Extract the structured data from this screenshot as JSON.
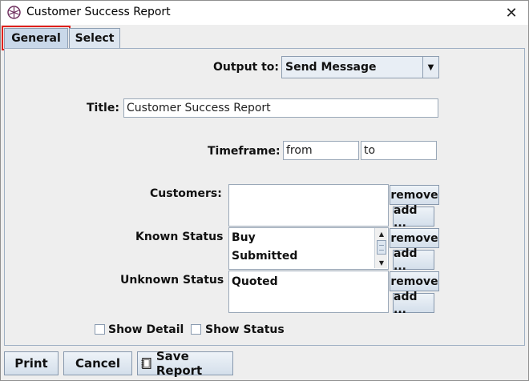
{
  "window": {
    "title": "Customer Success Report"
  },
  "tabs": [
    {
      "label": "General",
      "selected": true
    },
    {
      "label": "Select",
      "selected": false
    }
  ],
  "form": {
    "output_to": {
      "label": "Output to:",
      "value": "Send Message"
    },
    "title": {
      "label": "Title:",
      "value": "Customer Success Report"
    },
    "timeframe": {
      "label": "Timeframe:",
      "from_placeholder": "from",
      "to_placeholder": "to"
    },
    "customers": {
      "label": "Customers:",
      "items": []
    },
    "known_status": {
      "label": "Known Status",
      "items": [
        "Buy",
        "Submitted"
      ]
    },
    "unknown_status": {
      "label": "Unknown Status",
      "items": [
        "Quoted"
      ]
    },
    "remove_label": "remove",
    "add_label": "add ...",
    "show_detail": {
      "label": "Show Detail",
      "checked": false
    },
    "show_status": {
      "label": "Show Status",
      "checked": false
    }
  },
  "footer": {
    "print_label": "Print",
    "cancel_label": "Cancel",
    "save_label": "Save Report"
  }
}
